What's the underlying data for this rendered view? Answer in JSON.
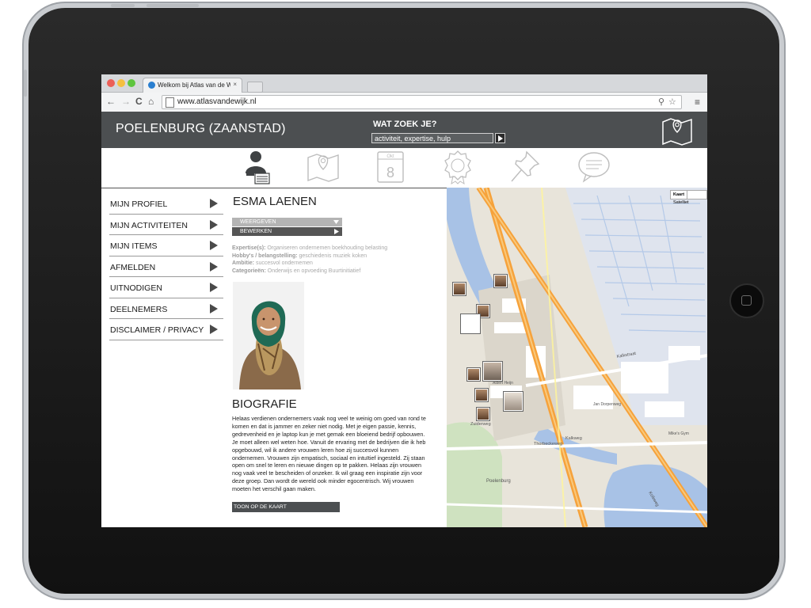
{
  "browser": {
    "tab_title": "Welkom bij Atlas van de W",
    "tab_close": "×",
    "url": "www.atlasvandewijk.nl",
    "nav": {
      "back": "←",
      "forward": "→",
      "reload": "C",
      "home": "⌂"
    }
  },
  "site": {
    "title": "POELENBURG (ZAANSTAD)",
    "search_label": "WAT ZOEK JE?",
    "search_value": "activiteit, expertise, hulp"
  },
  "icon_nav": [
    "profile-icon",
    "map-icon",
    "calendar-icon",
    "badge-icon",
    "pin-icon",
    "chat-icon"
  ],
  "calendar": {
    "day": "8",
    "label": "Okt"
  },
  "menu": [
    {
      "label": "MIJN PROFIEL"
    },
    {
      "label": "MIJN ACTIVITEITEN"
    },
    {
      "label": "MIJN ITEMS"
    },
    {
      "label": "AFMELDEN"
    },
    {
      "label": "UITNODIGEN"
    },
    {
      "label": "DEELNEMERS"
    },
    {
      "label": "DISCLAIMER / PRIVACY"
    }
  ],
  "profile": {
    "name": "ESMA LAENEN",
    "btn_view": "WEERGEVEN",
    "btn_edit": "BEWERKEN",
    "expertise_label": "Expertise(s):",
    "expertise": "Organiseren  ondernemen  boekhouding  belasting",
    "hobby_label": "Hobby's / belangstelling:",
    "hobby": "geschiedenis  muziek  koken",
    "ambition_label": "Ambitie:",
    "ambition": "succesvol ondernemen",
    "categories_label": "Categorieën:",
    "categories": "Onderwijs en opvoeding  Buurtinitiatief",
    "bio_title": "BIOGRAFIE",
    "bio": "Helaas verdienen ondernemers vaak nog veel te weinig om goed van rond te komen en dat is jammer en zeker niet nodig. Met je eigen passie, kennis, gedrevenheid en je laptop kun je met gemak een bloeiend bedrijf opbouwen. Je moet alleen wel weten hoe. Vanuit de ervaring met de bedrijven die ik heb opgebouwd, wil ik andere vrouwen leren hoe zij succesvol kunnen ondernemen. Vrouwen zijn empatisch, sociaal en intuïtief ingesteld. Zij staan open om snel te leren en nieuwe dingen op te pakken. Helaas zijn vrouwen nog vaak veel te bescheiden of onzeker. Ik wil graag een inspiratie zijn voor deze groep. Dan wordt de wereld ook minder egocentrisch. Wij vrouwen moeten het verschil gaan maken.",
    "show_on_map": "TOON OP DE KAART"
  },
  "map": {
    "toggle_map": "Kaart",
    "toggle_sat": "Satelliet",
    "labels": [
      "Poelenburg",
      "Kalkstraat",
      "Kalkweg",
      "Thorbeckeweg",
      "Zuiderweg",
      "Albert Heijn",
      "Jan Dorpenweg",
      "Mike's Gym",
      "Kolkweg"
    ]
  },
  "colors": {
    "header_bg": "#4c4f51",
    "map_highway": "#f6a23b",
    "map_water": "#a8c2e6",
    "map_land": "#e6e2d8"
  }
}
